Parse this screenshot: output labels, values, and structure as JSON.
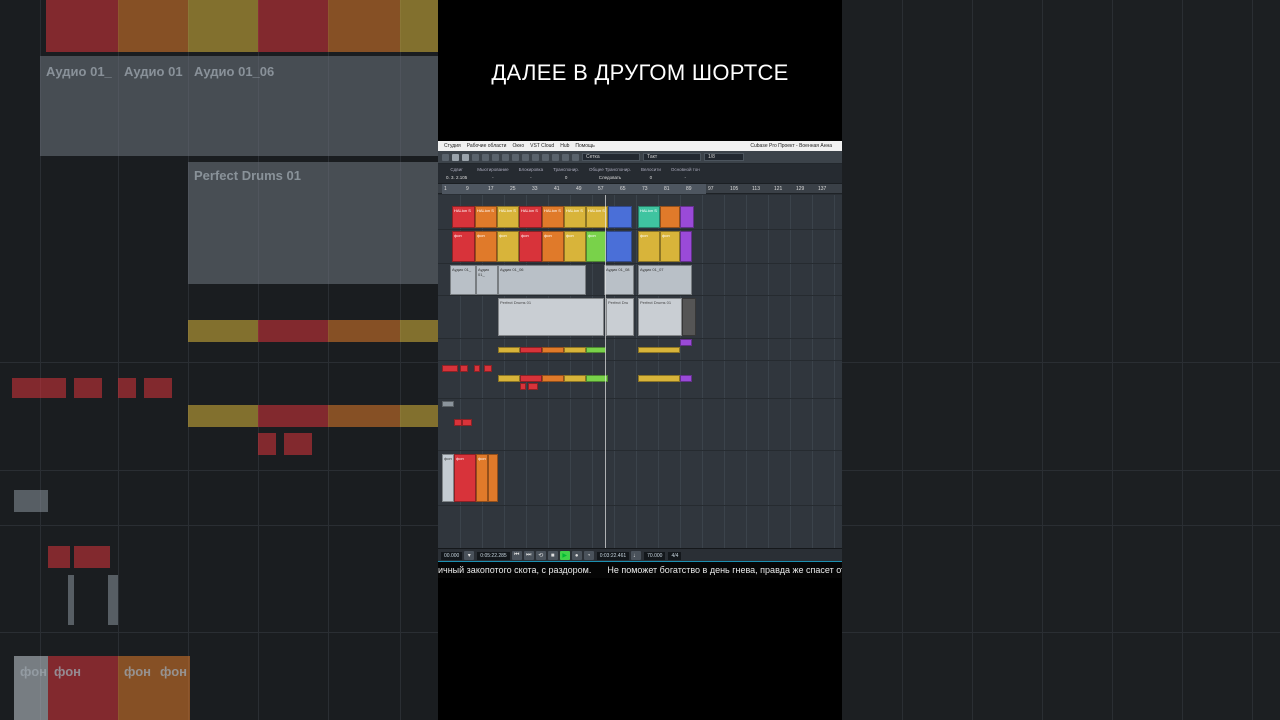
{
  "video": {
    "headline": "ДАЛЕЕ В ДРУГОМ ШОРТСЕ",
    "subtitle_left": "ичный закопотого скота, с раздором.",
    "subtitle_right": "Не поможет богатство в день гнева, правда же спасет от смерти"
  },
  "daw": {
    "menu": [
      "Студия",
      "Рабочие области",
      "Окно",
      "VST Cloud",
      "Hub",
      "Помощь"
    ],
    "window_title": "Cubase Pro Проект - Военная Анна",
    "toolbar": {
      "snap_type": "Сетка",
      "grid_type": "Такт",
      "quantize": "1/8"
    },
    "infoline": [
      {
        "label": "Сдвиг",
        "value": "0. 3. 2.105"
      },
      {
        "label": "Мьютирование",
        "value": "-"
      },
      {
        "label": "Блокировка",
        "value": "-"
      },
      {
        "label": "Транспонир.",
        "value": "0"
      },
      {
        "label": "Общее Транспонир.",
        "value": "Следовать"
      },
      {
        "label": "Велосити",
        "value": "0"
      },
      {
        "label": "Основной тон",
        "value": "-"
      }
    ],
    "ruler_bars": [
      "1",
      "9",
      "17",
      "25",
      "33",
      "41",
      "49",
      "57",
      "65",
      "73",
      "81",
      "89",
      "97",
      "105",
      "113",
      "121",
      "129",
      "137"
    ],
    "part_labels": {
      "audio_1": "Аудио 01_",
      "audio_2": "Аудио 01_",
      "audio_3": "Аудио 01_06",
      "audio_4": "Аудио 01_08",
      "audio_5": "Аудио 01_07",
      "drums_1": "Perfect Drums 01",
      "drums_2": "Perfect Dru",
      "drums_3": "Perfect Drums 01",
      "halion": "HALion S",
      "fon": "фон"
    },
    "transport": {
      "left_time": "00.000",
      "primary_time": "0:05:22.285",
      "secondary_time": "0:03:22.461",
      "tempo": "70.000",
      "signature": "4/4"
    }
  },
  "background_left": {
    "audio_label_1": "Аудио 01_",
    "audio_label_2": "Аудио 01",
    "audio_label_3": "Аудио 01_06",
    "drums_label": "Perfect Drums 01",
    "fon_label": "фон"
  },
  "colors": {
    "red": "#d8333a",
    "orange": "#e07a2a",
    "yellow": "#d8b43a",
    "green": "#79d24a",
    "blue": "#4a6fd8",
    "purple": "#9a4ad8",
    "teal": "#3fc4a0",
    "play_green": "#3fd24a"
  }
}
